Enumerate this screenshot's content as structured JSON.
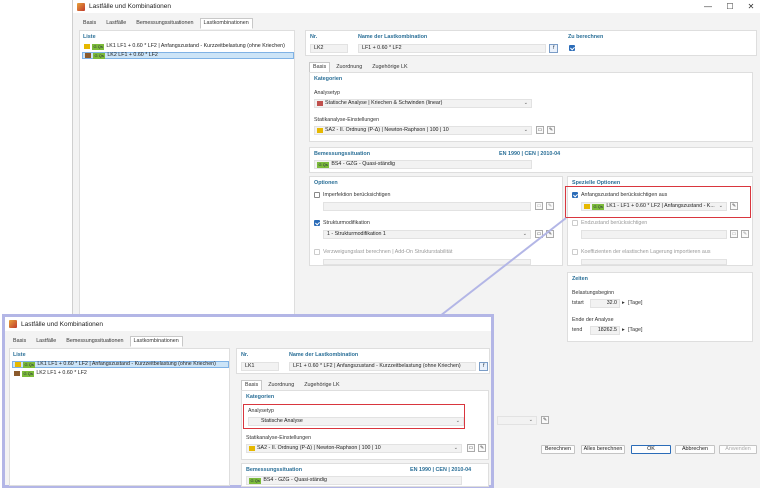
{
  "window": {
    "title": "Lastfälle und Kombinationen",
    "tabs": [
      "Basis",
      "Lastfälle",
      "Bemessungssituationen",
      "Lastkombinationen"
    ],
    "minimize": "—",
    "maximize": "☐",
    "close": "✕"
  },
  "liste": {
    "header": "Liste",
    "items": [
      {
        "id": "LK1",
        "badge": "G Qs",
        "text": "LF1 + 0.60 * LF2 | Anfangszustand - Kurzzeitbelastung (ohne Kriechen)",
        "color": "#e6b800"
      },
      {
        "id": "LK2",
        "badge": "G Qs",
        "text": "LF1 + 0.60 * LF2",
        "color": "#8b5a2b"
      }
    ]
  },
  "detail": {
    "nr_label": "Nr.",
    "nr_value": "LK2",
    "name_label": "Name der Lastkombination",
    "name_value": "LF1 + 0.60 * LF2",
    "zu_berechnen_label": "Zu berechnen",
    "subtabs": [
      "Basis",
      "Zuordnung",
      "Zugehörige LK"
    ],
    "kategorien": "Kategorien",
    "analysetyp_label": "Analysetyp",
    "analysetyp_value": "Statische Analyse | Kriechen & Schwinden (linear)",
    "statik_label": "Statikanalyse-Einstellungen",
    "statik_value": "SA2 - II. Ordnung (P-Δ) | Newton-Raphson | 100 | 10",
    "bemess_label": "Bemessungssituation",
    "bemess_norm": "EN 1990 | CEN | 2010-04",
    "bemess_value": "BS4 - GZG - Quasi-ständig",
    "optionen": "Optionen",
    "imperfektion": "Imperfektion berücksichtigen",
    "strukturmod": "Strukturmodifikation",
    "strukturmod_value": "1 - Strukturmodifikation 1",
    "verzweigung": "Verzweigungslast berechnen | Add-On Strukturstabilität",
    "spezielle": "Spezielle Optionen",
    "anfangszustand": "Anfangszustand berücksichtigen aus",
    "anfangszustand_value": "LK1 - LF1 + 0.60 * LF2 | Anfangszustand - K...",
    "endzustand": "Endzustand berücksichtigen",
    "koeffizienten": "Koeffizienten der elastischen Lagerung importieren aus",
    "zeiten": "Zeiten",
    "belastungsbeginn": "Belastungsbeginn",
    "tstart_label": "tstart",
    "tstart_value": "32.0",
    "tage": "[Tage]",
    "ende_analyse": "Ende der Analyse",
    "tend_label": "tend",
    "tend_value": "18262.5"
  },
  "buttons": [
    "Berechnen",
    "Alles berechnen",
    "OK",
    "Abbrechen",
    "Anwenden"
  ],
  "popup": {
    "title": "Lastfälle und Kombinationen",
    "tabs": [
      "Basis",
      "Lastfälle",
      "Bemessungssituationen",
      "Lastkombinationen"
    ],
    "liste_header": "Liste",
    "items": [
      {
        "id": "LK1",
        "badge": "G Qs",
        "text": "LF1 + 0.60 * LF2 | Anfangszustand - Kurzzeitbelastung (ohne Kriechen)"
      },
      {
        "id": "LK2",
        "badge": "G Qs",
        "text": "LF1 + 0.60 * LF2"
      }
    ],
    "nr_label": "Nr.",
    "nr_value": "LK1",
    "name_label": "Name der Lastkombination",
    "name_value": "LF1 + 0.60 * LF2 | Anfangszustand - Kurzzeitbelastung (ohne Kriechen)",
    "subtabs": [
      "Basis",
      "Zuordnung",
      "Zugehörige LK"
    ],
    "kategorien": "Kategorien",
    "analysetyp_label": "Analysetyp",
    "analysetyp_value": "Statische Analyse",
    "statik_label": "Statikanalyse-Einstellungen",
    "statik_value": "SA2 - II. Ordnung (P-Δ) | Newton-Raphson | 100 | 10",
    "bemess_label": "Bemessungssituation",
    "bemess_norm": "EN 1990 | CEN | 2010-04",
    "bemess_value": "BS4 - GZG - Quasi-ständig"
  },
  "colors": {
    "accent": "#2b6cb8",
    "header": "#2a6f97",
    "highlight": "#d9363e",
    "popup_border": "#b3b6e6",
    "selection": "#cce4f7"
  }
}
